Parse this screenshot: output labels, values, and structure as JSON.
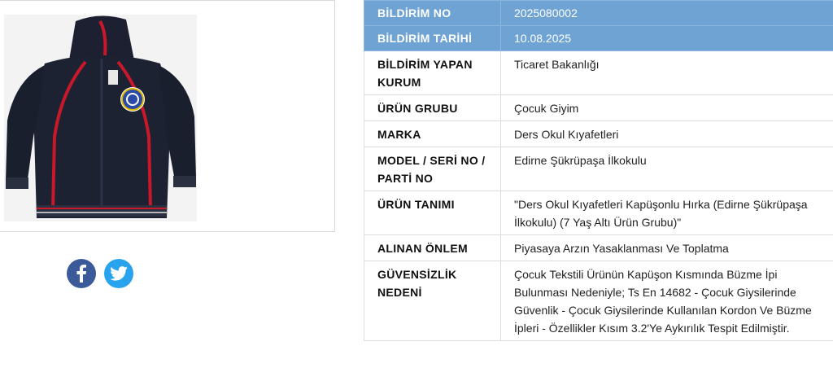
{
  "rows": [
    {
      "label": "BİLDİRİM NO",
      "value": "2025080002"
    },
    {
      "label": "BİLDİRİM TARİHİ",
      "value": "10.08.2025"
    },
    {
      "label": "BİLDİRİM YAPAN KURUM",
      "value": "Ticaret Bakanlığı"
    },
    {
      "label": "ÜRÜN GRUBU",
      "value": "Çocuk Giyim"
    },
    {
      "label": "MARKA",
      "value": "Ders Okul Kıyafetleri"
    },
    {
      "label": "MODEL / SERİ NO / PARTİ NO",
      "value": "Edirne Şükrüpaşa İlkokulu"
    },
    {
      "label": "ÜRÜN TANIMI",
      "value": "\"Ders Okul Kıyafetleri Kapüşonlu Hırka (Edirne Şükrüpaşa İlkokulu) (7 Yaş Altı Ürün Grubu)\""
    },
    {
      "label": "ALINAN ÖNLEM",
      "value": "Piyasaya Arzın Yasaklanması Ve Toplatma"
    },
    {
      "label": "GÜVENSİZLİK NEDENİ",
      "value": "Çocuk Tekstili Ürünün Kapüşon Kısmında Büzme İpi Bulunması Nedeniyle; Ts En 14682 - Çocuk Giysilerinde Güvenlik - Çocuk Giysilerinde Kullanılan Kordon Ve Büzme İpleri - Özellikler Kısım 3.2'Ye Aykırılık Tespit Edilmiştir."
    }
  ],
  "social": {
    "facebook": "facebook-icon",
    "twitter": "twitter-icon"
  },
  "colors": {
    "header_bg": "#6fa3d4",
    "facebook": "#3b5a9a",
    "twitter": "#2aa3ef"
  }
}
